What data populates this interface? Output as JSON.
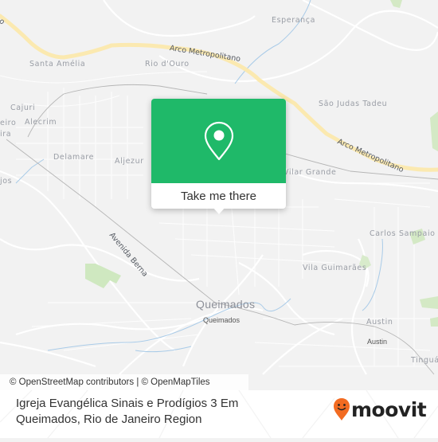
{
  "map": {
    "labels": {
      "esperanca": "Esperança",
      "santa_amelia": "Santa Amélia",
      "rio_douro": "Rio d'Ouro",
      "sao_judas_tadeu": "São Judas Tadeu",
      "cajuri": "Cajuri",
      "alecrim": "Alecrim",
      "eiro_partial": "eiro",
      "ira_partial": "ira",
      "delamare": "Delamare",
      "aljezur": "Aljezur",
      "vilar_grande": "Vilar Grande",
      "jos_partial": "jos",
      "carlos_sampaio": "Carlos Sampaio",
      "vila_guimaraes": "Vila Guimarães",
      "queimados_city": "Queimados",
      "queimados_station": "Queimados",
      "austin": "Austin",
      "austin_station": "Austin",
      "tingua_partial": "Tinguá"
    },
    "roads": {
      "arco_partial_left": "o",
      "arco_1": "Arco Metropolitano",
      "arco_2": "Arco Metropolitano",
      "avenida_berna": "Avenida Berna"
    },
    "colors": {
      "background": "#f2f2f2",
      "highway": "#fbe9b0",
      "park": "#cfe8c0",
      "water": "#a9cbe8",
      "rail": "#b9b9b9"
    }
  },
  "popup": {
    "icon": "location-pin-icon",
    "button_label": "Take me there",
    "color": "#1fb969"
  },
  "attribution": "© OpenStreetMap contributors | © OpenMapTiles",
  "footer": {
    "place_title": "Igreja Evangélica Sinais e Prodígios 3 Em Queimados, Rio de Janeiro Region",
    "brand": "moovit",
    "brand_color": "#f26b21"
  }
}
